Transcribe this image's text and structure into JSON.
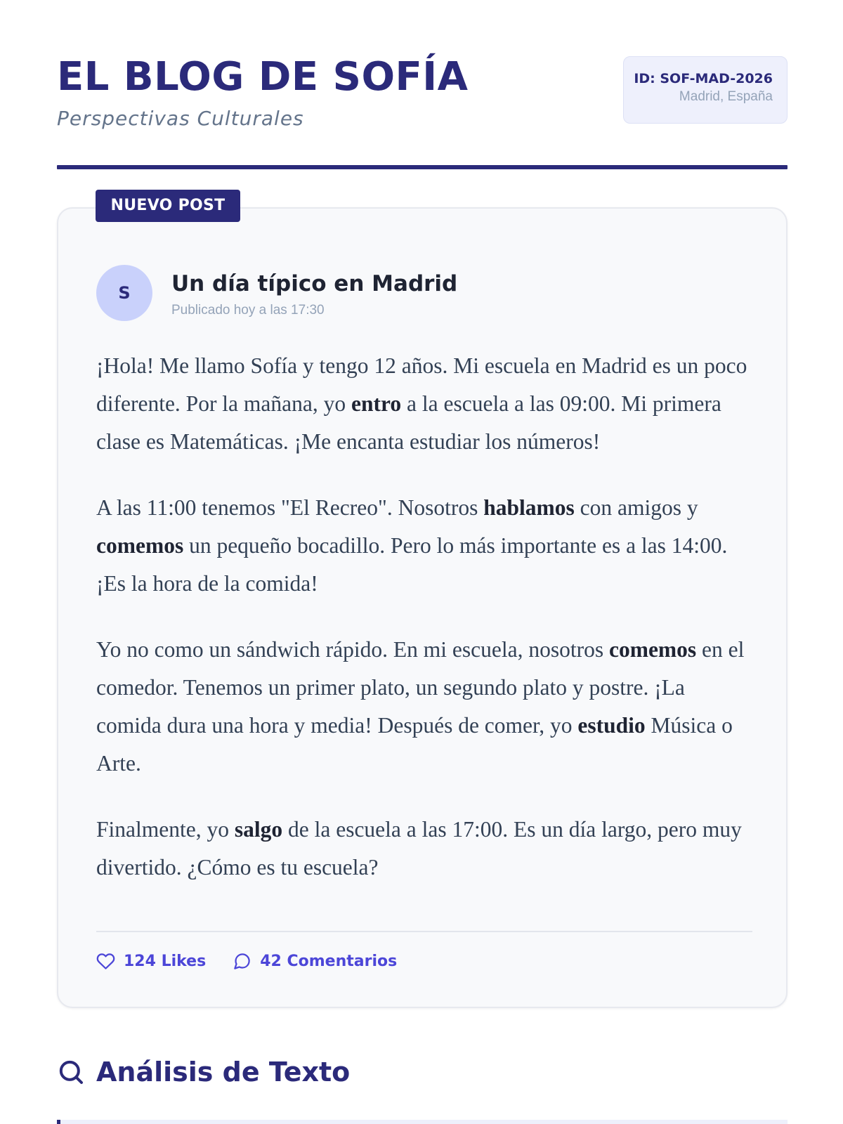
{
  "header": {
    "title": "EL BLOG DE SOFÍA",
    "subtitle": "Perspectivas Culturales",
    "badge": {
      "id": "ID: SOF-MAD-2026",
      "location": "Madrid, España"
    }
  },
  "post": {
    "tag": "NUEVO POST",
    "avatar_initial": "S",
    "title": "Un día típico en Madrid",
    "meta": "Publicado hoy a las 17:30",
    "paragraphs": [
      [
        {
          "text": "¡Hola! Me llamo Sofía y tengo 12 años. Mi escuela en Madrid es un poco diferente. Por la mañana, yo "
        },
        {
          "text": "entro",
          "bold": true
        },
        {
          "text": " a la escuela a las 09:00. Mi primera clase es Matemáticas. ¡Me encanta estudiar los números!"
        }
      ],
      [
        {
          "text": "A las 11:00 tenemos \"El Recreo\". Nosotros "
        },
        {
          "text": "hablamos",
          "bold": true
        },
        {
          "text": " con amigos y "
        },
        {
          "text": "comemos",
          "bold": true
        },
        {
          "text": " un pequeño bocadillo. Pero lo más importante es a las 14:00. ¡Es la hora de la comida!"
        }
      ],
      [
        {
          "text": "Yo no como un sándwich rápido. En mi escuela, nosotros "
        },
        {
          "text": "comemos",
          "bold": true
        },
        {
          "text": " en el comedor. Tenemos un primer plato, un segundo plato y postre. ¡La comida dura una hora y media! Después de comer, yo "
        },
        {
          "text": "estudio",
          "bold": true
        },
        {
          "text": " Música o Arte."
        }
      ],
      [
        {
          "text": "Finalmente, yo "
        },
        {
          "text": "salgo",
          "bold": true
        },
        {
          "text": " de la escuela a las 17:00. Es un día largo, pero muy divertido. ¿Cómo es tu escuela?"
        }
      ]
    ],
    "likes_label": "124 Likes",
    "comments_label": "42 Comentarios"
  },
  "analysis": {
    "heading": "Análisis de Texto"
  },
  "icons": {
    "likes": "heart-icon",
    "comments": "comment-icon",
    "analysis": "search-icon"
  },
  "colors": {
    "brand": "#2b2a7a",
    "accent": "#4c46d8",
    "avatar_bg": "#c9d1fb",
    "card_bg": "#f8f9fb",
    "badge_bg": "#eef0fc"
  }
}
